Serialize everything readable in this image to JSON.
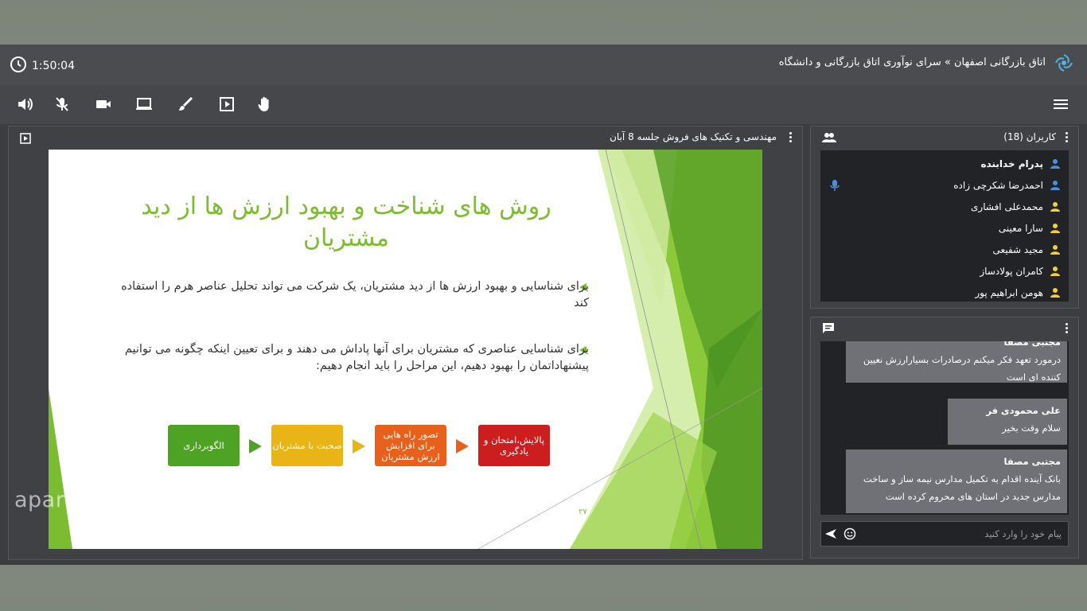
{
  "header": {
    "timer": "1:50:04",
    "room_title": "اتاق بازرگانی اصفهان » سرای نوآوری اتاق بازرگانی و دانشگاه"
  },
  "toolbar": {
    "icons": [
      "speaker-icon",
      "mic-muted-icon",
      "camera-icon",
      "screen-share-icon",
      "brush-icon",
      "play-media-icon",
      "raise-hand-icon",
      "menu-icon"
    ]
  },
  "presentation": {
    "title": "مهندسی و تکنیک های فروش جلسه 8 آبان",
    "slide": {
      "heading": "روش های شناخت و بهبود ارزش ها از دید مشتریان",
      "bullet1": "برای شناسایی و بهبود ارزش ها از دید مشتریان، یک شرکت می تواند تحلیل عناصر هرم را استفاده کند",
      "bullet2": "برای شناسایی عناصری که مشتریان برای آنها پاداش می دهند و برای تعیین اینکه چگونه می توانیم پیشنهاداتمان را بهبود دهیم، این مراحل را باید انجام دهیم:",
      "steps": [
        {
          "label": "پالایش،امتحان و یادگیری",
          "color": "#cc1e1e"
        },
        {
          "label": "تصور راه هایی برای افزایش ارزش مشتریان",
          "color": "#e8611c"
        },
        {
          "label": "صحبت با مشتریان",
          "color": "#e9b416"
        },
        {
          "label": "الگوبرداری",
          "color": "#4ea325"
        }
      ],
      "page_number": "۲۷"
    }
  },
  "users": {
    "title": "کاربران (18)",
    "list": [
      {
        "name": "پدرام خدابنده",
        "role": "presenter",
        "color": "#4a90e2",
        "bold": true
      },
      {
        "name": "احمدرضا شکرچی زاده",
        "role": "moderator",
        "color": "#4a90e2",
        "mic": true
      },
      {
        "name": "محمدعلی افشاری",
        "role": "viewer",
        "color": "#f3cf3b"
      },
      {
        "name": "سارا معینی",
        "role": "viewer",
        "color": "#f3cf3b"
      },
      {
        "name": "مجید شفیعی",
        "role": "viewer",
        "color": "#f3cf3b"
      },
      {
        "name": "کامران پولادساز",
        "role": "viewer",
        "color": "#f3cf3b"
      },
      {
        "name": "هومن ابراهیم پور",
        "role": "viewer",
        "color": "#f3cf3b"
      }
    ]
  },
  "chat": {
    "messages": [
      {
        "sender": "مجتبی مصفا",
        "text": "درمورد تعهد فکر میکنم درصادرات بسیارارزش نعیین کننده ای است"
      },
      {
        "sender": "علی محمودی فر",
        "text": "سلام وقت بخیر"
      },
      {
        "sender": "مجتبی مصفا",
        "text": "بانک آینده اقدام به تکمیل مدارس نیمه ساز و ساخت مدارس جدید در استان های محروم کرده است"
      }
    ],
    "placeholder": "پیام خود را وارد کنید"
  },
  "watermark": "aparat.com/Osoul_innovation"
}
